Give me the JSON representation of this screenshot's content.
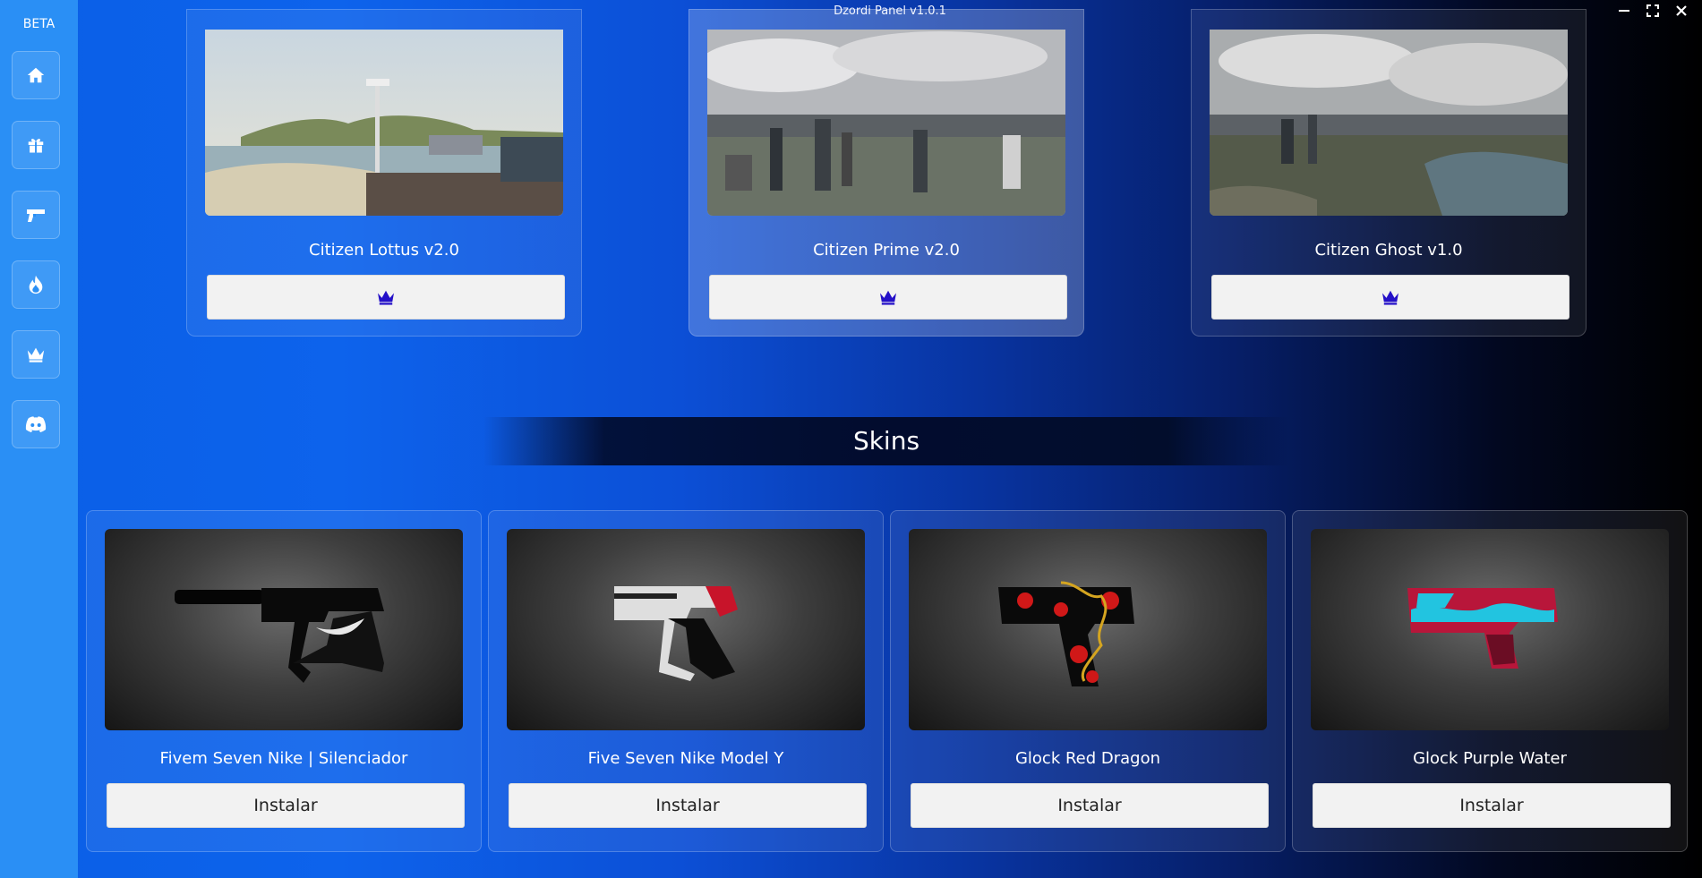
{
  "window": {
    "title": "Dzordi Panel v1.0.1",
    "controls": [
      "minimize-icon",
      "maximize-icon",
      "close-icon"
    ]
  },
  "sidebar": {
    "badge": "BETA",
    "items": [
      {
        "icon": "home-icon"
      },
      {
        "icon": "gift-icon"
      },
      {
        "icon": "gun-icon"
      },
      {
        "icon": "fire-icon"
      },
      {
        "icon": "crown-icon"
      },
      {
        "icon": "discord-icon"
      }
    ]
  },
  "servers": [
    {
      "name": "Citizen Lottus v2.0",
      "button_icon": "crown-icon"
    },
    {
      "name": "Citizen Prime v2.0",
      "button_icon": "crown-icon"
    },
    {
      "name": "Citizen Ghost v1.0",
      "button_icon": "crown-icon"
    }
  ],
  "skins_section": {
    "title": "Skins",
    "items": [
      {
        "name": "Fivem Seven Nike | Silenciador",
        "button": "Instalar"
      },
      {
        "name": "Five Seven Nike Model Y",
        "button": "Instalar"
      },
      {
        "name": "Glock Red Dragon",
        "button": "Instalar"
      },
      {
        "name": "Glock Purple Water",
        "button": "Instalar"
      }
    ]
  },
  "colors": {
    "sidebar": "#2a8ff5",
    "crown_accent": "#2410c8",
    "button_bg": "#f2f2f2"
  }
}
